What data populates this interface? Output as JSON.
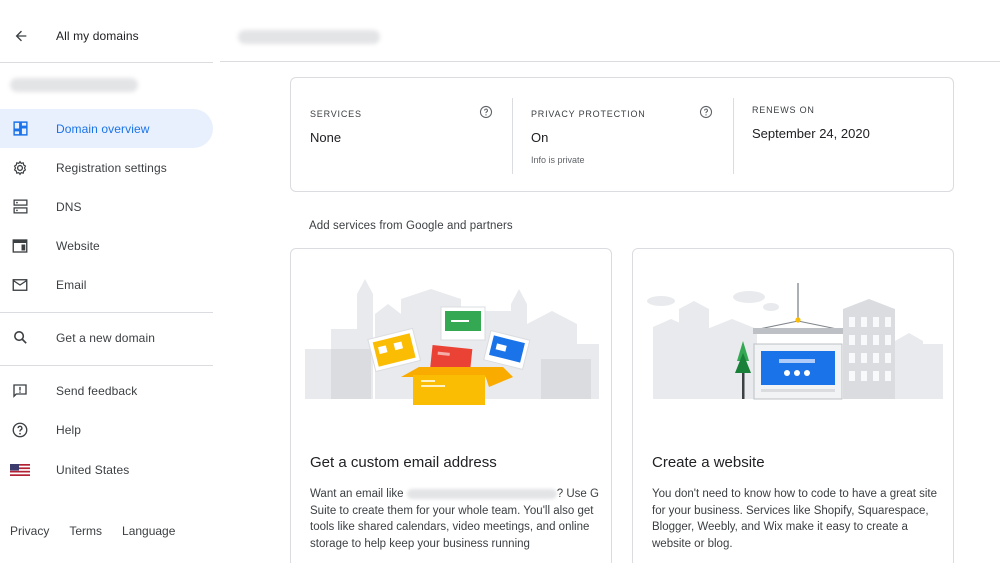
{
  "sidebar": {
    "back_label": "All my domains",
    "items": [
      {
        "label": "Domain overview",
        "icon": "dashboard-icon",
        "active": true
      },
      {
        "label": "Registration settings",
        "icon": "gear-icon"
      },
      {
        "label": "DNS",
        "icon": "dns-icon"
      },
      {
        "label": "Website",
        "icon": "website-icon"
      },
      {
        "label": "Email",
        "icon": "mail-icon"
      },
      {
        "label": "Get a new domain",
        "icon": "search-icon"
      },
      {
        "label": "Send feedback",
        "icon": "feedback-icon"
      },
      {
        "label": "Help",
        "icon": "help-icon"
      },
      {
        "label": "United States",
        "icon": "us-flag-icon"
      }
    ],
    "footer": {
      "privacy": "Privacy",
      "terms": "Terms",
      "language": "Language"
    }
  },
  "overview": {
    "services": {
      "heading": "SERVICES",
      "value": "None"
    },
    "privacy": {
      "heading": "PRIVACY PROTECTION",
      "value": "On",
      "sub": "Info is private"
    },
    "renews": {
      "heading": "RENEWS ON",
      "value": "September 24, 2020"
    }
  },
  "section_title": "Add services from Google and partners",
  "cards": {
    "email": {
      "title": "Get a custom email address",
      "body_before": "Want an email like ",
      "body_after": "? Use G Suite to create them for your whole team. You'll also get tools like shared calendars, video meetings, and online storage to help keep your business running"
    },
    "website": {
      "title": "Create a website",
      "body": "You don't need to know how to code to have a great site for your business. Services like Shopify, Squarespace, Blogger, Weebly, and Wix make it easy to create a website or blog."
    }
  },
  "colors": {
    "accent": "#1a73e8",
    "active_bg": "#e8f0fe",
    "border": "#dadce0"
  }
}
